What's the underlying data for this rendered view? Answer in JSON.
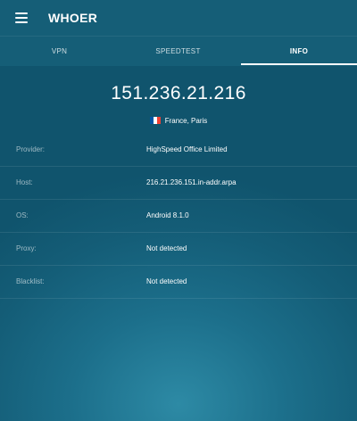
{
  "app": {
    "title": "WHOER",
    "menu_icon": "menu-icon"
  },
  "tabs": [
    {
      "label": "VPN",
      "active": false
    },
    {
      "label": "SPEEDTEST",
      "active": false
    },
    {
      "label": "INFO",
      "active": true
    }
  ],
  "info": {
    "ip": "151.236.21.216",
    "location": "France, Paris",
    "flag_icon": "france-flag-icon",
    "flag_colors": [
      "#0055a4",
      "#ffffff",
      "#ef4135"
    ],
    "rows": [
      {
        "label": "Provider:",
        "value": "HighSpeed Office Limited"
      },
      {
        "label": "Host:",
        "value": "216.21.236.151.in-addr.arpa"
      },
      {
        "label": "OS:",
        "value": "Android 8.1.0"
      },
      {
        "label": "Proxy:",
        "value": "Not detected"
      },
      {
        "label": "Blacklist:",
        "value": "Not detected"
      }
    ]
  },
  "colors": {
    "appbar": "#155e77",
    "background": "#1c6f8b",
    "text": "#ffffff"
  }
}
